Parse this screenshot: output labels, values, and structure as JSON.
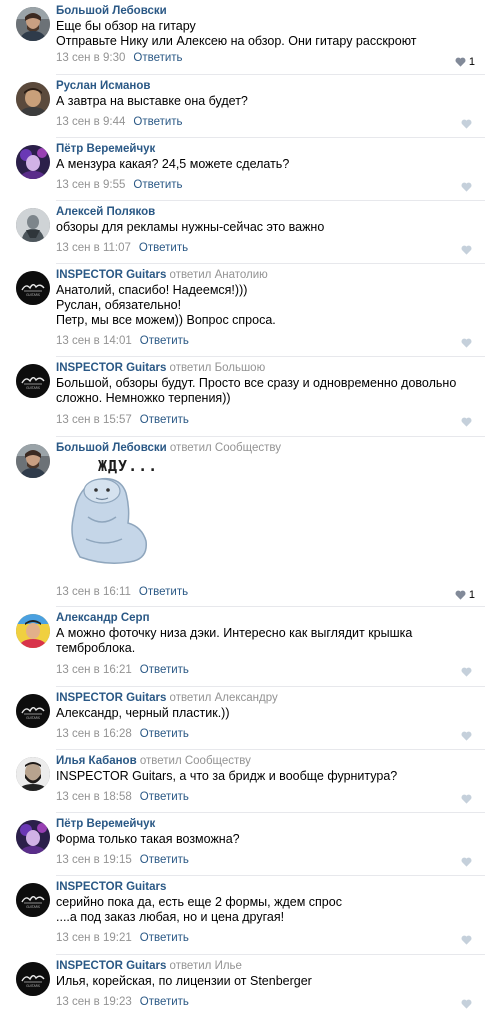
{
  "comments": [
    {
      "id": "c1",
      "author": "Большой Лебовски",
      "reply_word": "",
      "reply_to": "",
      "lines": [
        "Еще бы обзор на гитару",
        "Отправьте Нику или Алексею на обзор. Они гитару расскроют"
      ],
      "date": "13 сен в 9:30",
      "reply_label": "Ответить",
      "likes": "1",
      "like_color": "#828a99",
      "avatar": "lebowski"
    },
    {
      "id": "c2",
      "author": "Руслан Исманов",
      "reply_word": "",
      "reply_to": "",
      "lines": [
        "А завтра на выставке она будет?"
      ],
      "date": "13 сен в 9:44",
      "reply_label": "Ответить",
      "likes": "",
      "like_color": "#c5d0db",
      "avatar": "ruslan"
    },
    {
      "id": "c3",
      "author": "Пётр Веремейчук",
      "reply_word": "",
      "reply_to": "",
      "lines": [
        "А мензура какая? 24,5 можете сделать?"
      ],
      "date": "13 сен в 9:55",
      "reply_label": "Ответить",
      "likes": "",
      "like_color": "#c5d0db",
      "avatar": "petr"
    },
    {
      "id": "c4",
      "author": "Алексей Поляков",
      "reply_word": "",
      "reply_to": "",
      "lines": [
        "обзоры для рекламы нужны-сейчас это важно"
      ],
      "date": "13 сен в 11:07",
      "reply_label": "Ответить",
      "likes": "",
      "like_color": "#c5d0db",
      "avatar": "aleksey"
    },
    {
      "id": "c5",
      "author": "INSPECTOR Guitars",
      "reply_word": "ответил",
      "reply_to": "Анатолию",
      "lines": [
        "Анатолий, спасибо! Надеемся!)))",
        "Руслан, обязательно!",
        "Петр, мы все можем)) Вопрос спроса."
      ],
      "date": "13 сен в 14:01",
      "reply_label": "Ответить",
      "likes": "",
      "like_color": "#c5d0db",
      "avatar": "inspector"
    },
    {
      "id": "c6",
      "author": "INSPECTOR Guitars",
      "reply_word": "ответил",
      "reply_to": "Большою",
      "lines": [
        "Большой, обзоры будут. Просто все сразу и одновременно довольно",
        "сложно. Немножко терпения))"
      ],
      "date": "13 сен в 15:57",
      "reply_label": "Ответить",
      "likes": "",
      "like_color": "#c5d0db",
      "avatar": "inspector"
    },
    {
      "id": "c7",
      "author": "Большой Лебовски",
      "reply_word": "ответил",
      "reply_to": "Сообществу",
      "lines": [],
      "sticker_text": "ЖДУ...",
      "date": "13 сен в 16:11",
      "reply_label": "Ответить",
      "likes": "1",
      "like_color": "#828a99",
      "avatar": "lebowski"
    },
    {
      "id": "c8",
      "author": "Александр Серп",
      "reply_word": "",
      "reply_to": "",
      "lines": [
        "А можно фоточку низа дэки. Интересно как выглядит крышка",
        "темброблока."
      ],
      "date": "13 сен в 16:21",
      "reply_label": "Ответить",
      "likes": "",
      "like_color": "#c5d0db",
      "avatar": "aleksandr"
    },
    {
      "id": "c9",
      "author": "INSPECTOR Guitars",
      "reply_word": "ответил",
      "reply_to": "Александру",
      "lines": [
        "Александр, черный пластик.))"
      ],
      "date": "13 сен в 16:28",
      "reply_label": "Ответить",
      "likes": "",
      "like_color": "#c5d0db",
      "avatar": "inspector"
    },
    {
      "id": "c10",
      "author": "Илья Кабанов",
      "reply_word": "ответил",
      "reply_to": "Сообществу",
      "lines": [
        "INSPECTOR Guitars, а что за бридж и вообще фурнитура?"
      ],
      "date": "13 сен в 18:58",
      "reply_label": "Ответить",
      "likes": "",
      "like_color": "#c5d0db",
      "avatar": "ilya"
    },
    {
      "id": "c11",
      "author": "Пётр Веремейчук",
      "reply_word": "",
      "reply_to": "",
      "lines": [
        "Форма только такая возможна?"
      ],
      "date": "13 сен в 19:15",
      "reply_label": "Ответить",
      "likes": "",
      "like_color": "#c5d0db",
      "avatar": "petr"
    },
    {
      "id": "c12",
      "author": "INSPECTOR Guitars",
      "reply_word": "",
      "reply_to": "",
      "lines": [
        "серийно пока да, есть еще 2 формы, ждем спрос",
        "....а под заказ любая, но и цена другая!"
      ],
      "date": "13 сен в 19:21",
      "reply_label": "Ответить",
      "likes": "",
      "like_color": "#c5d0db",
      "avatar": "inspector"
    },
    {
      "id": "c13",
      "author": "INSPECTOR Guitars",
      "reply_word": "ответил",
      "reply_to": "Илье",
      "lines": [
        "Илья, корейская, по лицензии от Stenberger"
      ],
      "date": "13 сен в 19:23",
      "reply_label": "Ответить",
      "likes": "",
      "like_color": "#c5d0db",
      "avatar": "inspector"
    }
  ],
  "icons": {
    "like": "heart-icon",
    "brand_logo": "inspector-logo-icon"
  },
  "colors": {
    "link": "#2a5885",
    "muted": "#939393",
    "like_active": "#828a99",
    "like_idle": "#c5d0db",
    "divider": "#e7e8ec"
  }
}
